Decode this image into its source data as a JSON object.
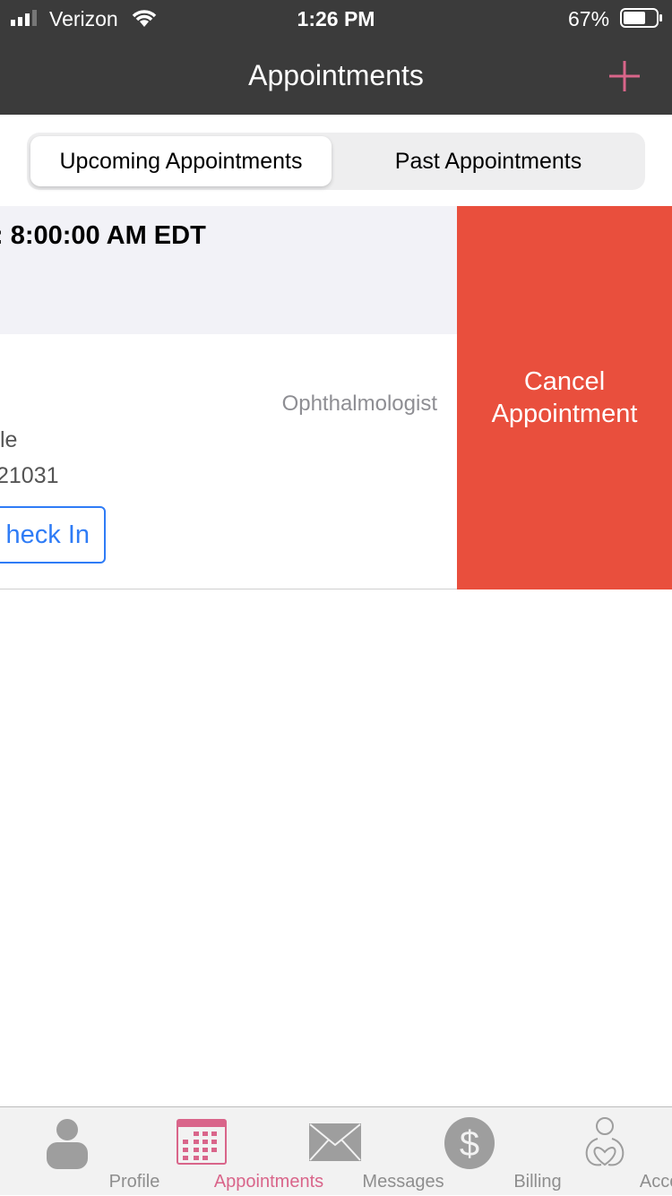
{
  "status_bar": {
    "carrier": "Verizon",
    "time": "1:26 PM",
    "battery": "67%"
  },
  "header": {
    "title": "Appointments",
    "add_icon": "plus-icon"
  },
  "segments": {
    "upcoming": "Upcoming Appointments",
    "past": "Past Appointments"
  },
  "appointment": {
    "time_fragment": ": 8:00:00 AM EDT",
    "specialty": "Ophthalmologist",
    "line1_fragment": "le",
    "line2_fragment": "21031",
    "check_in": "heck In"
  },
  "swipe_action": {
    "cancel": "Cancel Appointment"
  },
  "tabs": [
    {
      "label": "Profile",
      "icon": "person-icon"
    },
    {
      "label": "Appointments",
      "icon": "calendar-icon",
      "active": true
    },
    {
      "label": "Messages",
      "icon": "envelope-icon"
    },
    {
      "label": "Billing",
      "icon": "dollar-icon"
    },
    {
      "label": "Account",
      "icon": "account-heart-icon"
    }
  ],
  "colors": {
    "accent": "#d9658a",
    "cancel": "#e94f3d",
    "link": "#2f7cf6",
    "header": "#3b3b3b"
  }
}
